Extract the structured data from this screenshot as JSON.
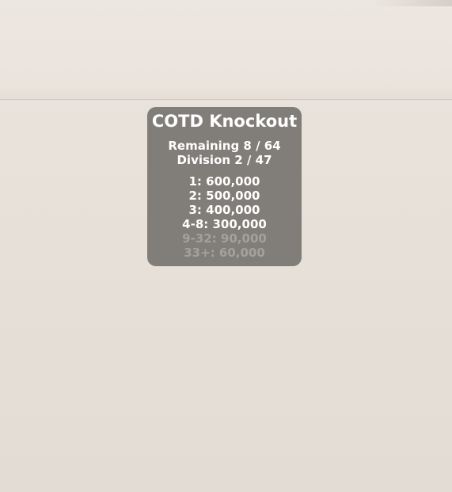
{
  "overlay": {
    "title": "COTD Knockout",
    "remaining": "Remaining 8 / 64",
    "division": "Division 2 / 47",
    "prizes": [
      {
        "text": "1: 600,000",
        "dim": false
      },
      {
        "text": "2: 500,000",
        "dim": false
      },
      {
        "text": "3: 400,000",
        "dim": false
      },
      {
        "text": "4-8: 300,000",
        "dim": false
      },
      {
        "text": "9-32: 90,000",
        "dim": true
      },
      {
        "text": "33+: 60,000",
        "dim": true
      }
    ]
  },
  "colors": {
    "panel_background": "#706c68",
    "text_primary": "#ffffff",
    "text_dim": "#a7a4a1",
    "scene_background": "#e8e2db"
  }
}
